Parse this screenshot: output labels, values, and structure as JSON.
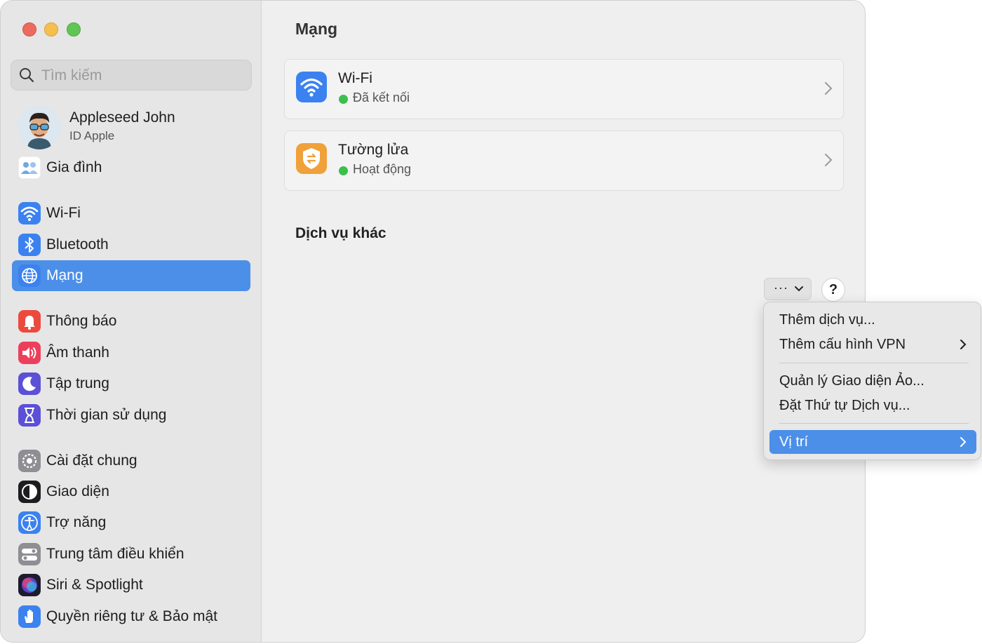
{
  "sidebar": {
    "search_placeholder": "Tìm kiếm",
    "profile": {
      "name": "Appleseed John",
      "subtitle": "ID Apple"
    },
    "items": [
      {
        "label": "Gia đình",
        "icon": "family-icon"
      },
      {
        "label": "Wi-Fi",
        "icon": "wifi-icon"
      },
      {
        "label": "Bluetooth",
        "icon": "bluetooth-icon"
      },
      {
        "label": "Mạng",
        "icon": "network-globe-icon",
        "selected": true
      },
      {
        "label": "Thông báo",
        "icon": "notification-bell-icon"
      },
      {
        "label": "Âm thanh",
        "icon": "speaker-icon"
      },
      {
        "label": "Tập trung",
        "icon": "moon-icon"
      },
      {
        "label": "Thời gian sử dụng",
        "icon": "hourglass-icon"
      },
      {
        "label": "Cài đặt chung",
        "icon": "gear-icon"
      },
      {
        "label": "Giao diện",
        "icon": "appearance-icon"
      },
      {
        "label": "Trợ năng",
        "icon": "accessibility-icon"
      },
      {
        "label": "Trung tâm điều khiển",
        "icon": "control-center-icon"
      },
      {
        "label": "Siri & Spotlight",
        "icon": "siri-icon"
      },
      {
        "label": "Quyền riêng tư & Bảo mật",
        "icon": "privacy-hand-icon"
      }
    ]
  },
  "main": {
    "title": "Mạng",
    "cards": [
      {
        "title": "Wi-Fi",
        "status": "Đã kết nối",
        "icon": "wifi-icon"
      },
      {
        "title": "Tường lửa",
        "status": "Hoạt động",
        "icon": "firewall-icon"
      }
    ],
    "section_title": "Dịch vụ khác",
    "more_button": "···",
    "help_button": "?"
  },
  "menu": {
    "items": [
      {
        "label": "Thêm dịch vụ..."
      },
      {
        "label": "Thêm cấu hình VPN",
        "submenu": true
      },
      {
        "label": "Quản lý Giao diện Ảo..."
      },
      {
        "label": "Đặt Thứ tự Dịch vụ..."
      },
      {
        "label": "Vị trí",
        "submenu": true,
        "highlighted": true
      }
    ]
  },
  "colors": {
    "accent": "#4b8fe8",
    "status_green": "#3dbf4d"
  }
}
